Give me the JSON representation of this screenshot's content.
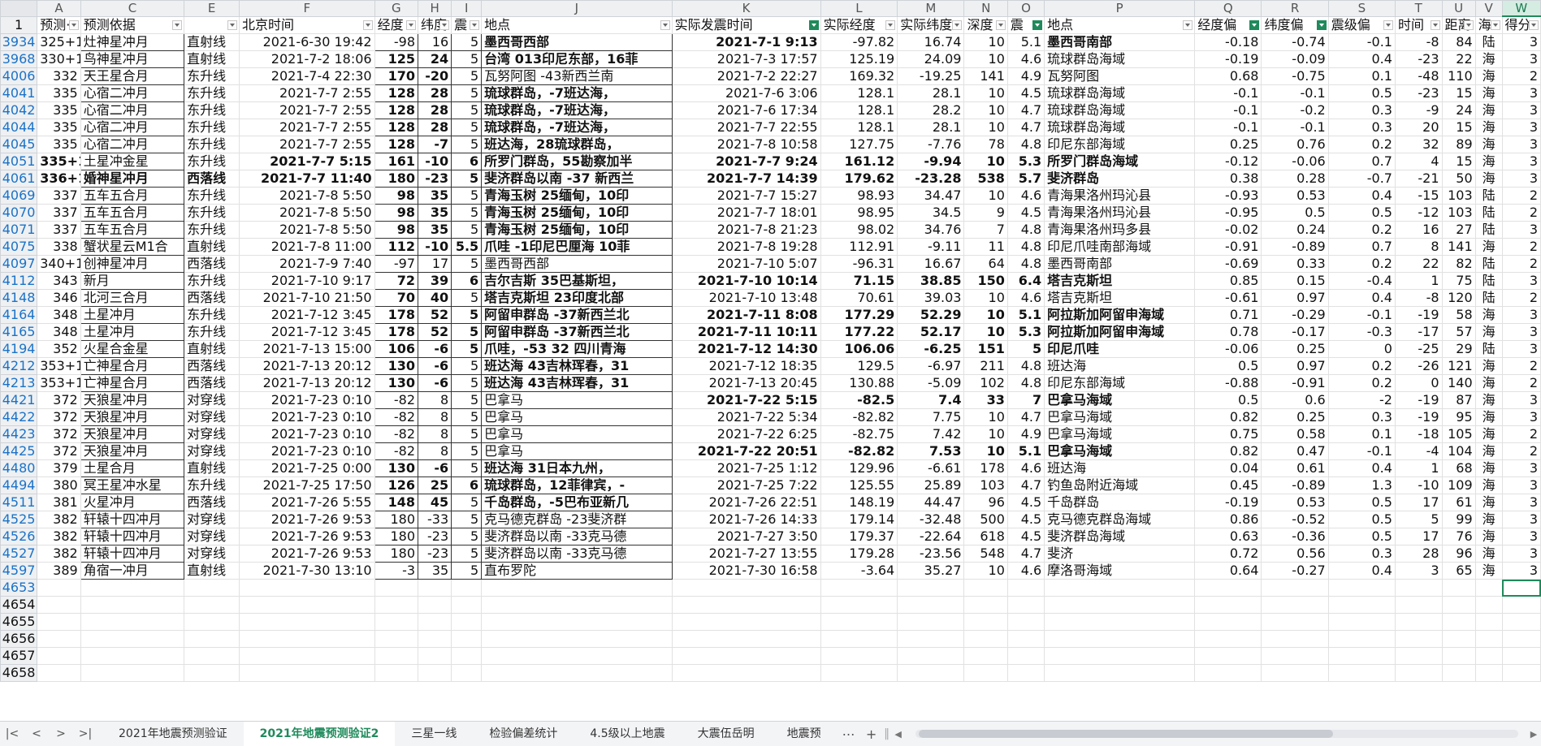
{
  "app": {
    "accent_color": "#1f8a5b",
    "red_text_color": "#e0201c",
    "filter_link_color": "#1a72c8"
  },
  "columns": [
    "A",
    "C",
    "E",
    "F",
    "G",
    "H",
    "I",
    "J",
    "K",
    "L",
    "M",
    "N",
    "O",
    "P",
    "Q",
    "R",
    "S",
    "T",
    "U",
    "V",
    "W"
  ],
  "header_row_number": "1",
  "headers": [
    "预测·",
    "预测依据",
    "",
    "北京时间",
    "经度",
    "纬度",
    "震",
    "地点",
    "实际发震时间",
    "实际经度",
    "实际纬度",
    "深度",
    "震",
    "地点",
    "经度偏",
    "纬度偏",
    "震级偏",
    "时间",
    "距离",
    "海",
    "得分"
  ],
  "headers_filter_active": [
    false,
    false,
    false,
    false,
    false,
    false,
    false,
    false,
    true,
    false,
    false,
    false,
    true,
    false,
    true,
    true,
    false,
    false,
    false,
    false,
    false
  ],
  "rows": [
    {
      "n": "3934",
      "c": [
        "325+1",
        "灶神星冲月",
        "直射线",
        "2021-6-30 19:42",
        "-98",
        "16",
        "5",
        "墨西哥西部",
        "2021-7-1  9:13",
        "-97.82",
        "16.74",
        "10",
        "5.1",
        "墨西哥南部",
        "-0.18",
        "-0.74",
        "-0.1",
        "-8",
        "84",
        "陆",
        "3"
      ],
      "s": "bgroup"
    },
    {
      "n": "3968",
      "c": [
        "330+1",
        "鸟神星冲月",
        "直射线",
        "2021-7-2 18:06",
        "125",
        "24",
        "5",
        "台湾 013印尼东部，16菲",
        "2021-7-3 17:57",
        "125.19",
        "24.09",
        "10",
        "4.6",
        "琉球群岛海域",
        "-0.19",
        "-0.09",
        "0.4",
        "-23",
        "22",
        "海",
        "3"
      ],
      "s": "redge"
    },
    {
      "n": "4006",
      "c": [
        "332",
        "天王星合月",
        "东升线",
        "2021-7-4 22:30",
        "170",
        "-20",
        "5",
        "瓦努阿图  -43新西兰南",
        "2021-7-2 22:27",
        "169.32",
        "-19.25",
        "141",
        "4.9",
        "瓦努阿图",
        "0.68",
        "-0.75",
        "0.1",
        "-48",
        "110",
        "海",
        "2"
      ],
      "s": "bgroup2"
    },
    {
      "n": "4041",
      "c": [
        "335",
        "心宿二冲月",
        "东升线",
        "2021-7-7 2:55",
        "128",
        "28",
        "5",
        "琉球群岛，-7班达海，",
        "2021-7-6 3:06",
        "128.1",
        "28.1",
        "10",
        "4.5",
        "琉球群岛海域",
        "-0.1",
        "-0.1",
        "0.5",
        "-23",
        "15",
        "海",
        "3"
      ],
      "s": "bgroup3"
    },
    {
      "n": "4042",
      "c": [
        "335",
        "心宿二冲月",
        "东升线",
        "2021-7-7 2:55",
        "128",
        "28",
        "5",
        "琉球群岛，-7班达海，",
        "2021-7-6 17:34",
        "128.1",
        "28.2",
        "10",
        "4.7",
        "琉球群岛海域",
        "-0.1",
        "-0.2",
        "0.3",
        "-9",
        "24",
        "海",
        "3"
      ],
      "s": "bgroup3"
    },
    {
      "n": "4044",
      "c": [
        "335",
        "心宿二冲月",
        "东升线",
        "2021-7-7 2:55",
        "128",
        "28",
        "5",
        "琉球群岛，-7班达海，",
        "2021-7-7 22:55",
        "128.1",
        "28.1",
        "10",
        "4.7",
        "琉球群岛海域",
        "-0.1",
        "-0.1",
        "0.3",
        "20",
        "15",
        "海",
        "3"
      ],
      "s": "bgroup3"
    },
    {
      "n": "4045",
      "c": [
        "335",
        "心宿二冲月",
        "东升线",
        "2021-7-7 2:55",
        "128",
        "-7",
        "5",
        "班达海，28琉球群岛，",
        "2021-7-8 10:58",
        "127.75",
        "-7.76",
        "78",
        "4.8",
        "印尼东部海域",
        "0.25",
        "0.76",
        "0.2",
        "32",
        "89",
        "海",
        "3"
      ],
      "s": "bgroup3"
    },
    {
      "n": "4051",
      "c": [
        "335+1",
        "土星冲金星",
        "东升线",
        "2021-7-7 5:15",
        "161",
        "-10",
        "6",
        "所罗门群岛，55勘察加半",
        "2021-7-7 9:24",
        "161.12",
        "-9.94",
        "10",
        "5.3",
        "所罗门群岛海域",
        "-0.12",
        "-0.06",
        "0.7",
        "4",
        "15",
        "海",
        "3"
      ],
      "s": "big"
    },
    {
      "n": "4061",
      "c": [
        "336+1",
        "婚神星冲月",
        "西落线",
        "2021-7-7 11:40",
        "180",
        "-23",
        "5",
        "斐济群岛以南 -37 新西兰",
        "2021-7-7 14:39",
        "179.62",
        "-23.28",
        "538",
        "5.7",
        "斐济群岛",
        "0.38",
        "0.28",
        "-0.7",
        "-21",
        "50",
        "海",
        "3"
      ],
      "s": "big2"
    },
    {
      "n": "4069",
      "c": [
        "337",
        "五车五合月",
        "东升线",
        "2021-7-8 5:50",
        "98",
        "35",
        "5",
        "青海玉树 25缅甸，10印",
        "2021-7-7 15:27",
        "98.93",
        "34.47",
        "10",
        "4.6",
        "青海果洛州玛沁县",
        "-0.93",
        "0.53",
        "0.4",
        "-15",
        "103",
        "陆",
        "2"
      ],
      "s": "qh"
    },
    {
      "n": "4070",
      "c": [
        "337",
        "五车五合月",
        "东升线",
        "2021-7-8 5:50",
        "98",
        "35",
        "5",
        "青海玉树 25缅甸，10印",
        "2021-7-7 18:01",
        "98.95",
        "34.5",
        "9",
        "4.5",
        "青海果洛州玛沁县",
        "-0.95",
        "0.5",
        "0.5",
        "-12",
        "103",
        "陆",
        "2"
      ],
      "s": "qh"
    },
    {
      "n": "4071",
      "c": [
        "337",
        "五车五合月",
        "东升线",
        "2021-7-8 5:50",
        "98",
        "35",
        "5",
        "青海玉树 25缅甸，10印",
        "2021-7-8 21:23",
        "98.02",
        "34.76",
        "7",
        "4.8",
        "青海果洛州玛多县",
        "-0.02",
        "0.24",
        "0.2",
        "16",
        "27",
        "陆",
        "3"
      ],
      "s": "qh"
    },
    {
      "n": "4075",
      "c": [
        "338",
        "蟹状星云M1合",
        "直射线",
        "2021-7-8 11:00",
        "112",
        "-10",
        "5.5",
        "爪哇 -1印尼巴厘海 10菲",
        "2021-7-8 19:28",
        "112.91",
        "-9.11",
        "11",
        "4.8",
        "印尼爪哇南部海域",
        "-0.91",
        "-0.89",
        "0.7",
        "8",
        "141",
        "海",
        "2"
      ],
      "s": "java"
    },
    {
      "n": "4097",
      "c": [
        "340+1",
        "创神星冲月",
        "西落线",
        "2021-7-9 7:40",
        "-97",
        "17",
        "5",
        "墨西哥西部",
        "2021-7-10 5:07",
        "-96.31",
        "16.67",
        "64",
        "4.8",
        "墨西哥南部",
        "-0.69",
        "0.33",
        "0.2",
        "22",
        "82",
        "陆",
        "2"
      ],
      "s": "mex"
    },
    {
      "n": "4112",
      "c": [
        "343",
        "新月",
        "东升线",
        "2021-7-10 9:17",
        "72",
        "39",
        "6",
        "吉尔吉斯 35巴基斯坦，",
        "2021-7-10 10:14",
        "71.15",
        "38.85",
        "150",
        "6.4",
        "塔吉克斯坦",
        "0.85",
        "0.15",
        "-0.4",
        "1",
        "75",
        "陆",
        "3"
      ],
      "s": "kyr"
    },
    {
      "n": "4148",
      "c": [
        "346",
        "北河三合月",
        "西落线",
        "2021-7-10 21:50",
        "70",
        "40",
        "5",
        "塔吉克斯坦 23印度北部",
        "2021-7-10 13:48",
        "70.61",
        "39.03",
        "10",
        "4.6",
        "塔吉克斯坦",
        "-0.61",
        "0.97",
        "0.4",
        "-8",
        "120",
        "陆",
        "2"
      ],
      "s": "taj"
    },
    {
      "n": "4164",
      "c": [
        "348",
        "土星冲月",
        "东升线",
        "2021-7-12 3:45",
        "178",
        "52",
        "5",
        "阿留申群岛 -37新西兰北",
        "2021-7-11 8:08",
        "177.29",
        "52.29",
        "10",
        "5.1",
        "阿拉斯加阿留申海域",
        "0.71",
        "-0.29",
        "-0.1",
        "-19",
        "58",
        "海",
        "3"
      ],
      "s": "ale"
    },
    {
      "n": "4165",
      "c": [
        "348",
        "土星冲月",
        "东升线",
        "2021-7-12 3:45",
        "178",
        "52",
        "5",
        "阿留申群岛 -37新西兰北",
        "2021-7-11 10:11",
        "177.22",
        "52.17",
        "10",
        "5.3",
        "阿拉斯加阿留申海域",
        "0.78",
        "-0.17",
        "-0.3",
        "-17",
        "57",
        "海",
        "3"
      ],
      "s": "ale"
    },
    {
      "n": "4194",
      "c": [
        "352",
        "火星合金星",
        "直射线",
        "2021-7-13 15:00",
        "106",
        "-6",
        "5",
        "爪哇，-53  32 四川青海",
        "2021-7-12 14:30",
        "106.06",
        "-6.25",
        "151",
        "5",
        "印尼爪哇",
        "-0.06",
        "0.25",
        "0",
        "-25",
        "29",
        "陆",
        "3"
      ],
      "s": "java2"
    },
    {
      "n": "4212",
      "c": [
        "353+1",
        "亡神星合月",
        "西落线",
        "2021-7-13 20:12",
        "130",
        "-6",
        "5",
        "班达海 43吉林珲春，31",
        "2021-7-12 18:35",
        "129.5",
        "-6.97",
        "211",
        "4.8",
        "班达海",
        "0.5",
        "0.97",
        "0.2",
        "-26",
        "121",
        "海",
        "2"
      ],
      "s": "banda"
    },
    {
      "n": "4213",
      "c": [
        "353+1",
        "亡神星合月",
        "西落线",
        "2021-7-13 20:12",
        "130",
        "-6",
        "5",
        "班达海 43吉林珲春，31",
        "2021-7-13 20:45",
        "130.88",
        "-5.09",
        "102",
        "4.8",
        "印尼东部海域",
        "-0.88",
        "-0.91",
        "0.2",
        "0",
        "140",
        "海",
        "2"
      ],
      "s": "banda"
    },
    {
      "n": "4421",
      "c": [
        "372",
        "天狼星冲月",
        "对穿线",
        "2021-7-23 0:10",
        "-82",
        "8",
        "5",
        "巴拿马",
        "2021-7-22 5:15",
        "-82.5",
        "7.4",
        "33",
        "7",
        "巴拿马海域",
        "0.5",
        "0.6",
        "-2",
        "-19",
        "87",
        "海",
        "3"
      ],
      "s": "pan1"
    },
    {
      "n": "4422",
      "c": [
        "372",
        "天狼星冲月",
        "对穿线",
        "2021-7-23 0:10",
        "-82",
        "8",
        "5",
        "巴拿马",
        "2021-7-22 5:34",
        "-82.82",
        "7.75",
        "10",
        "4.7",
        "巴拿马海域",
        "0.82",
        "0.25",
        "0.3",
        "-19",
        "95",
        "海",
        "3"
      ],
      "s": "pan"
    },
    {
      "n": "4423",
      "c": [
        "372",
        "天狼星冲月",
        "对穿线",
        "2021-7-23 0:10",
        "-82",
        "8",
        "5",
        "巴拿马",
        "2021-7-22 6:25",
        "-82.75",
        "7.42",
        "10",
        "4.9",
        "巴拿马海域",
        "0.75",
        "0.58",
        "0.1",
        "-18",
        "105",
        "海",
        "2"
      ],
      "s": "pan"
    },
    {
      "n": "4425",
      "c": [
        "372",
        "天狼星冲月",
        "对穿线",
        "2021-7-23 0:10",
        "-82",
        "8",
        "5",
        "巴拿马",
        "2021-7-22 20:51",
        "-82.82",
        "7.53",
        "10",
        "5.1",
        "巴拿马海域",
        "0.82",
        "0.47",
        "-0.1",
        "-4",
        "104",
        "海",
        "2"
      ],
      "s": "pan4"
    },
    {
      "n": "4480",
      "c": [
        "379",
        "土星合月",
        "直射线",
        "2021-7-25 0:00",
        "130",
        "-6",
        "5",
        "班达海 31日本九州，",
        "2021-7-25 1:12",
        "129.96",
        "-6.61",
        "178",
        "4.6",
        "班达海",
        "0.04",
        "0.61",
        "0.4",
        "1",
        "68",
        "海",
        "3"
      ],
      "s": "banda2"
    },
    {
      "n": "4494",
      "c": [
        "380",
        "冥王星冲水星",
        "东升线",
        "2021-7-25 17:50",
        "126",
        "25",
        "6",
        "琉球群岛，12菲律宾，-",
        "2021-7-25 7:22",
        "125.55",
        "25.89",
        "103",
        "4.7",
        "钓鱼岛附近海域",
        "0.45",
        "-0.89",
        "1.3",
        "-10",
        "109",
        "海",
        "3"
      ],
      "s": "ryu"
    },
    {
      "n": "4511",
      "c": [
        "381",
        "火星冲月",
        "西落线",
        "2021-7-26 5:55",
        "148",
        "45",
        "5",
        "千岛群岛，-5巴布亚新几",
        "2021-7-26 22:51",
        "148.19",
        "44.47",
        "96",
        "4.5",
        "千岛群岛",
        "-0.19",
        "0.53",
        "0.5",
        "17",
        "61",
        "海",
        "3"
      ],
      "s": "kur"
    },
    {
      "n": "4525",
      "c": [
        "382",
        "轩辕十四冲月",
        "对穿线",
        "2021-7-26 9:53",
        "180",
        "-33",
        "5",
        "克马德克群岛 -23斐济群",
        "2021-7-26 14:33",
        "179.14",
        "-32.48",
        "500",
        "4.5",
        "克马德克群岛海域",
        "0.86",
        "-0.52",
        "0.5",
        "5",
        "99",
        "海",
        "3"
      ],
      "s": "ker"
    },
    {
      "n": "4526",
      "c": [
        "382",
        "轩辕十四冲月",
        "对穿线",
        "2021-7-26 9:53",
        "180",
        "-23",
        "5",
        "斐济群岛以南 -33克马德",
        "2021-7-27 3:50",
        "179.37",
        "-22.64",
        "618",
        "4.5",
        "斐济群岛海域",
        "0.63",
        "-0.36",
        "0.5",
        "17",
        "76",
        "海",
        "3"
      ],
      "s": "ker"
    },
    {
      "n": "4527",
      "c": [
        "382",
        "轩辕十四冲月",
        "对穿线",
        "2021-7-26 9:53",
        "180",
        "-23",
        "5",
        "斐济群岛以南 -33克马德",
        "2021-7-27 13:55",
        "179.28",
        "-23.56",
        "548",
        "4.7",
        "斐济",
        "0.72",
        "0.56",
        "0.3",
        "28",
        "96",
        "海",
        "3"
      ],
      "s": "ker"
    },
    {
      "n": "4597",
      "c": [
        "389",
        "角宿一冲月",
        "直射线",
        "2021-7-30 13:10",
        "-3",
        "35",
        "5",
        "直布罗陀",
        "2021-7-30 16:58",
        "-3.64",
        "35.27",
        "10",
        "4.6",
        "摩洛哥海域",
        "0.64",
        "-0.27",
        "0.4",
        "3",
        "65",
        "海",
        "3"
      ],
      "s": "gib"
    }
  ],
  "empty_rows": [
    "4653",
    "4654",
    "4655",
    "4656",
    "4657",
    "4658"
  ],
  "sheet_tabs": [
    "2021年地震预测验证",
    "2021年地震预测验证2",
    "三星一线",
    "检验偏差统计",
    "4.5级以上地震",
    "大震伍岳明",
    "地震预"
  ],
  "active_tab_index": 1,
  "icons": {
    "first": "first-sheet-icon",
    "prev": "prev-sheet-icon",
    "next": "next-sheet-icon",
    "last": "last-sheet-icon",
    "more": "more-tabs-icon",
    "add": "add-sheet-icon"
  }
}
